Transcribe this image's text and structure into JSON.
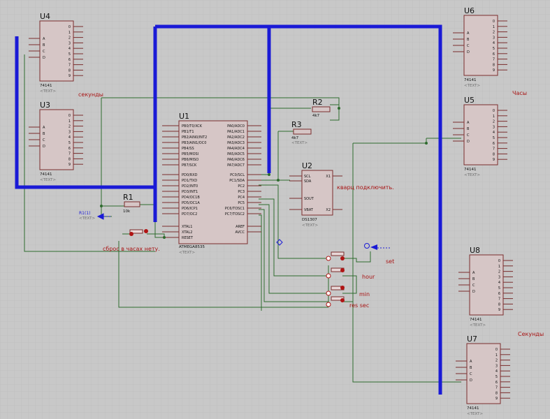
{
  "components": {
    "u4": {
      "ref": "U4",
      "part": "74141",
      "meta": "<TEXT>",
      "caption": "секунды"
    },
    "u3": {
      "ref": "U3",
      "part": "74141",
      "meta": "<TEXT>"
    },
    "u6": {
      "ref": "U6",
      "part": "74141",
      "meta": "<TEXT>",
      "caption": "Часы"
    },
    "u5": {
      "ref": "U5",
      "part": "74141",
      "meta": "<TEXT>"
    },
    "u8": {
      "ref": "U8",
      "part": "74141",
      "meta": "<TEXT>",
      "caption": "Секунды"
    },
    "u7": {
      "ref": "U7",
      "part": "74141",
      "meta": "<TEXT>"
    },
    "u1": {
      "ref": "U1",
      "part": "ATMEGA8535",
      "meta": "<TEXT>"
    },
    "u2": {
      "ref": "U2",
      "part": "DS1307",
      "meta": "<TEXT>",
      "caption": "кварц подключить."
    },
    "r1": {
      "ref": "R1",
      "value": "10k",
      "meta": "<TEXT>"
    },
    "r2": {
      "ref": "R2",
      "value": "4k7",
      "meta": "<TEXT>"
    },
    "r3": {
      "ref": "R3",
      "value": "4k7",
      "meta": "<TEXT>"
    },
    "r1_1": {
      "ref": "R1(1)",
      "meta": "<TEXT>"
    }
  },
  "labels": {
    "reset_note": "сброс в часах нету.",
    "set": "set",
    "hour": "hour",
    "min": "min",
    "res_sec": "res sec"
  },
  "u1_pins_left": [
    "PB0/T0/XCK",
    "PB1/T1",
    "PB2/AIN0/INT2",
    "PB3/AIN1/OC0",
    "PB4/SS",
    "PB5/MOSI",
    "PB6/MISO",
    "PB7/SCK",
    "PD0/RXD",
    "PD1/TXD",
    "PD2/INT0",
    "PD3/INT1",
    "PD4/OC1B",
    "PD5/OC1A",
    "PD6/ICP1",
    "PD7/OC2",
    "XTAL1",
    "XTAL2",
    "RESET"
  ],
  "u1_pins_right": [
    "PA0/ADC0",
    "PA1/ADC1",
    "PA2/ADC2",
    "PA3/ADC3",
    "PA4/ADC4",
    "PA5/ADC5",
    "PA6/ADC6",
    "PA7/ADC7",
    "PC0/SCL",
    "PC1/SDA",
    "PC2",
    "PC3",
    "PC4",
    "PC5",
    "PC6/TOSC1",
    "PC7/TOSC2",
    "AREF",
    "AVCC"
  ],
  "u2_pins": [
    "SCL",
    "SDA",
    "SOUT",
    "VBAT",
    "X1",
    "X2"
  ],
  "dec_inputs": [
    "A",
    "B",
    "C",
    "D"
  ],
  "dec_outputs": [
    "0",
    "1",
    "2",
    "3",
    "4",
    "5",
    "6",
    "7",
    "8",
    "9"
  ]
}
